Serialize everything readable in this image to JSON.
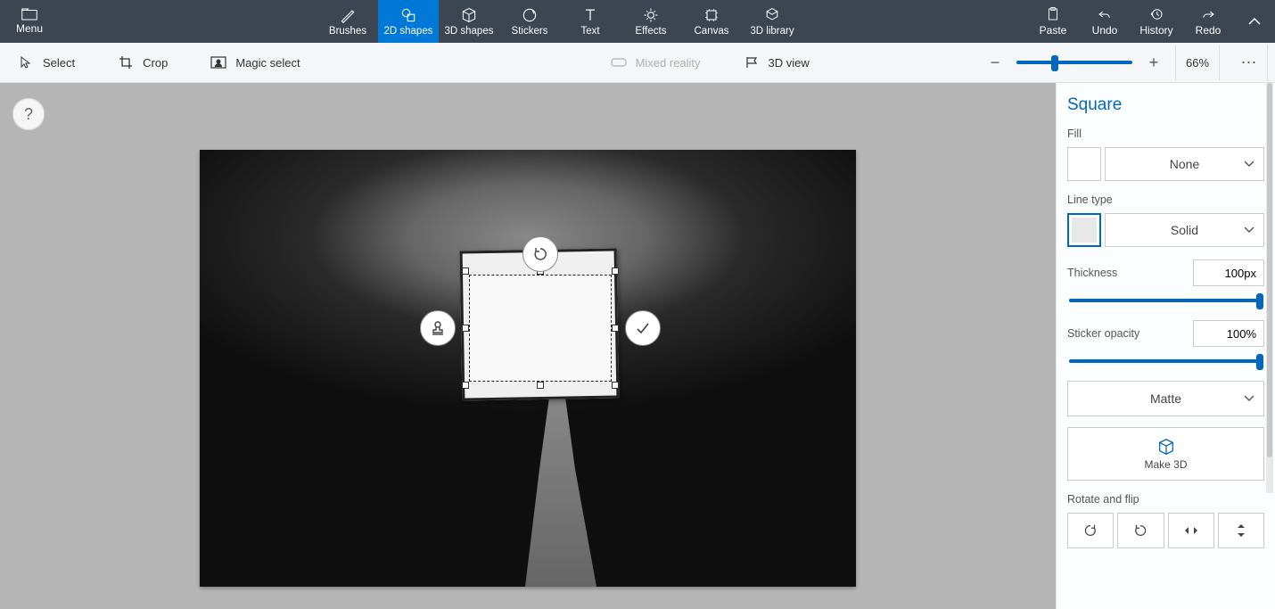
{
  "menu": {
    "label": "Menu"
  },
  "tabs": {
    "brushes": "Brushes",
    "shapes2d": "2D shapes",
    "shapes3d": "3D shapes",
    "stickers": "Stickers",
    "text": "Text",
    "effects": "Effects",
    "canvas": "Canvas",
    "library3d": "3D library"
  },
  "right": {
    "paste": "Paste",
    "undo": "Undo",
    "history": "History",
    "redo": "Redo"
  },
  "sub": {
    "select": "Select",
    "crop": "Crop",
    "magic": "Magic select",
    "mixed": "Mixed reality",
    "view3d": "3D view",
    "zoom_pct": "66%"
  },
  "panel": {
    "title": "Square",
    "fill_label": "Fill",
    "fill_value": "None",
    "line_label": "Line type",
    "line_value": "Solid",
    "thickness_label": "Thickness",
    "thickness_value": "100px",
    "opacity_label": "Sticker opacity",
    "opacity_value": "100%",
    "material_value": "Matte",
    "make3d_label": "Make 3D",
    "rotate_flip_label": "Rotate and flip"
  },
  "help": "?"
}
